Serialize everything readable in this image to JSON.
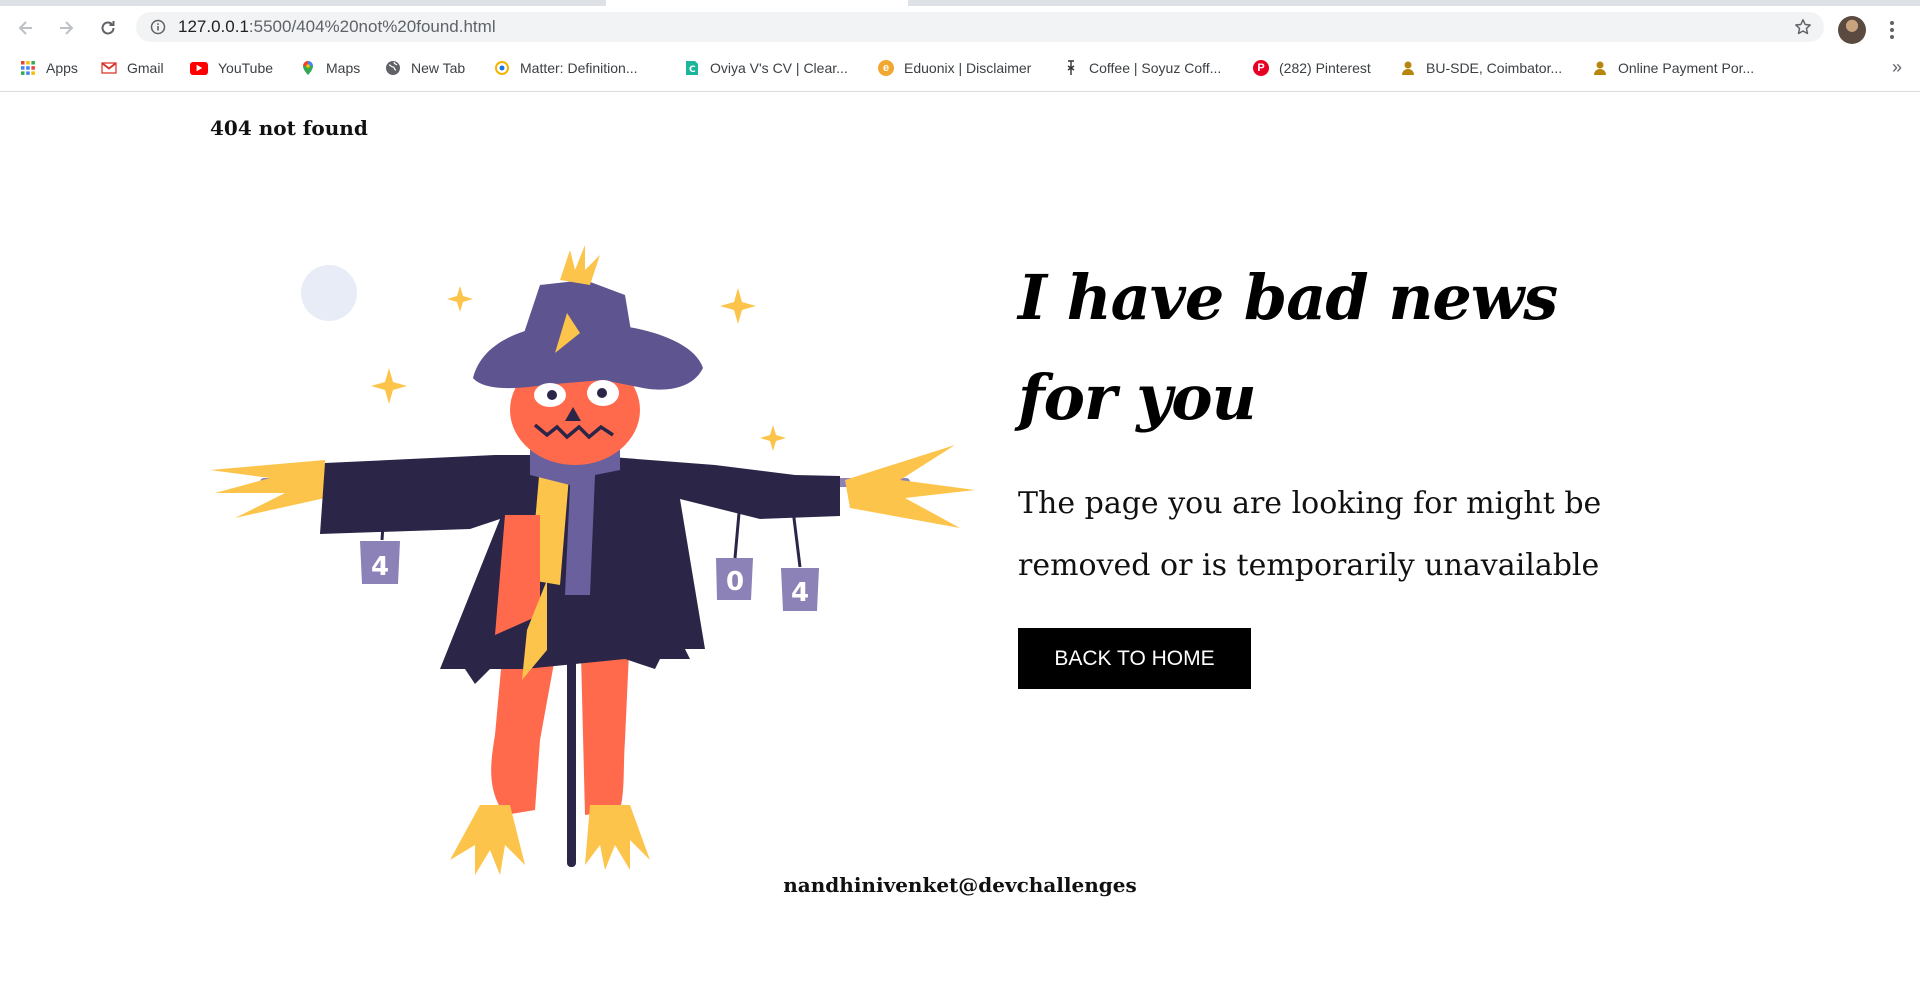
{
  "browser": {
    "url_host": "127.0.0.1",
    "url_path": ":5500/404%20not%20found.html",
    "bookmarks": [
      {
        "label": "Apps",
        "icon": "apps-grid-icon"
      },
      {
        "label": "Gmail",
        "icon": "gmail-icon",
        "color": "#d93025"
      },
      {
        "label": "YouTube",
        "icon": "youtube-icon",
        "color": "#ff0000"
      },
      {
        "label": "Maps",
        "icon": "maps-pin-icon",
        "color": "#34a853"
      },
      {
        "label": "New Tab",
        "icon": "globe-icon",
        "color": "#5f6368"
      },
      {
        "label": "Matter: Definition...",
        "icon": "matter-icon",
        "color": "#f4b400"
      },
      {
        "label": "Oviya V's CV | Clear...",
        "icon": "clearcv-icon",
        "color": "#1bb69a"
      },
      {
        "label": "Eduonix | Disclaimer",
        "icon": "eduonix-icon",
        "color": "#f0a830"
      },
      {
        "label": "Coffee | Soyuz Coff...",
        "icon": "soyuz-icon",
        "color": "#333333"
      },
      {
        "label": "(282) Pinterest",
        "icon": "pinterest-icon",
        "color": "#e60023"
      },
      {
        "label": "BU-SDE, Coimbator...",
        "icon": "bu-sde-icon",
        "color": "#b8860b"
      },
      {
        "label": "Online Payment Por...",
        "icon": "payment-icon",
        "color": "#b8860b"
      }
    ]
  },
  "page": {
    "header": "404 not found",
    "headline": "I have bad news for you",
    "subtext": "The page you are looking for might be removed or is temporarily unavailable",
    "button_label": "BACK TO HOME",
    "footer": "nandhinivenket@devchallenges",
    "can_labels": [
      "4",
      "0",
      "4"
    ]
  },
  "colors": {
    "accent": "#000000",
    "scarecrow_body": "#ff6a4d",
    "coat": "#2b2548",
    "hat": "#5e5490",
    "straw": "#fcc44a",
    "can": "#8d82b8"
  }
}
